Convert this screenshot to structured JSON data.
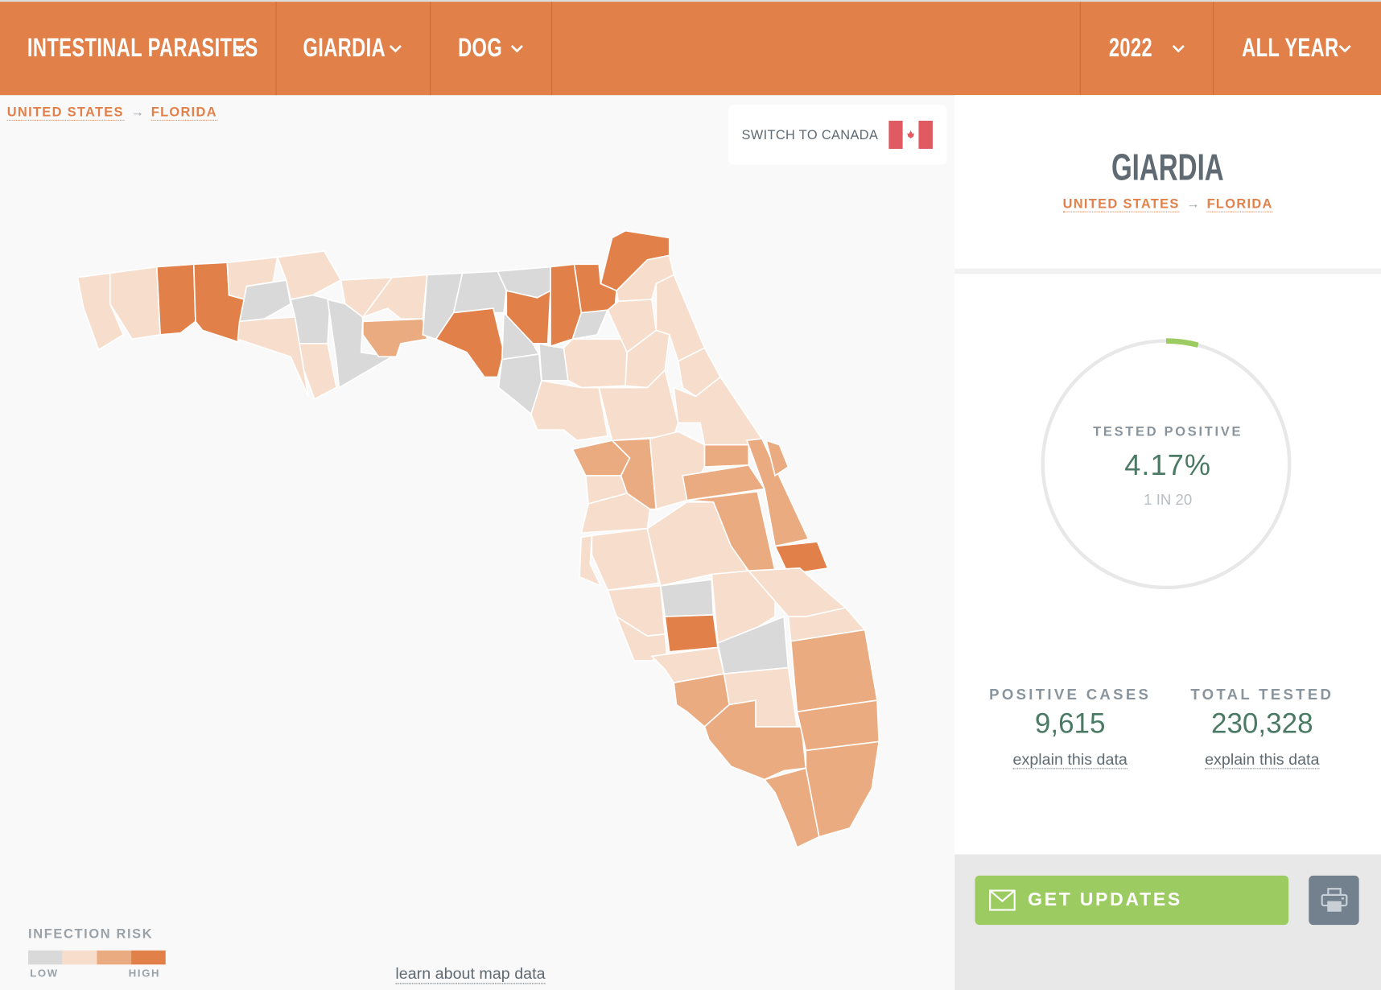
{
  "header": {
    "dropdowns": [
      {
        "label": "INTESTINAL PARASITES"
      },
      {
        "label": "GIARDIA"
      },
      {
        "label": "DOG"
      },
      {
        "label": "2022"
      },
      {
        "label": "ALL YEAR"
      }
    ]
  },
  "breadcrumb": {
    "country": "UNITED STATES",
    "arrow": "→",
    "state": "FLORIDA"
  },
  "switch_country": {
    "label": "SWITCH TO CANADA",
    "icon": "canada-flag-icon"
  },
  "panel": {
    "title": "GIARDIA",
    "breadcrumb": {
      "country": "UNITED STATES",
      "arrow": "→",
      "state": "FLORIDA"
    },
    "gauge": {
      "label": "TESTED POSITIVE",
      "value": "4.17%",
      "percent": 4.17,
      "ratio": "1 IN 20"
    },
    "stats": [
      {
        "label": "POSITIVE CASES",
        "value": "9,615",
        "link": "explain this data"
      },
      {
        "label": "TOTAL TESTED",
        "value": "230,328",
        "link": "explain this data"
      }
    ],
    "get_updates": "GET UPDATES",
    "print_icon": "printer-icon"
  },
  "legend": {
    "title": "INFECTION RISK",
    "low": "LOW",
    "high": "HIGH",
    "colors": [
      "#d9d9d9",
      "#f6ddcc",
      "#ebab80",
      "#e2804a"
    ]
  },
  "learn_link": "learn about map data",
  "colors": {
    "accent": "#e2804a",
    "green": "#9ccb61",
    "stat_text": "#4a7a64"
  }
}
